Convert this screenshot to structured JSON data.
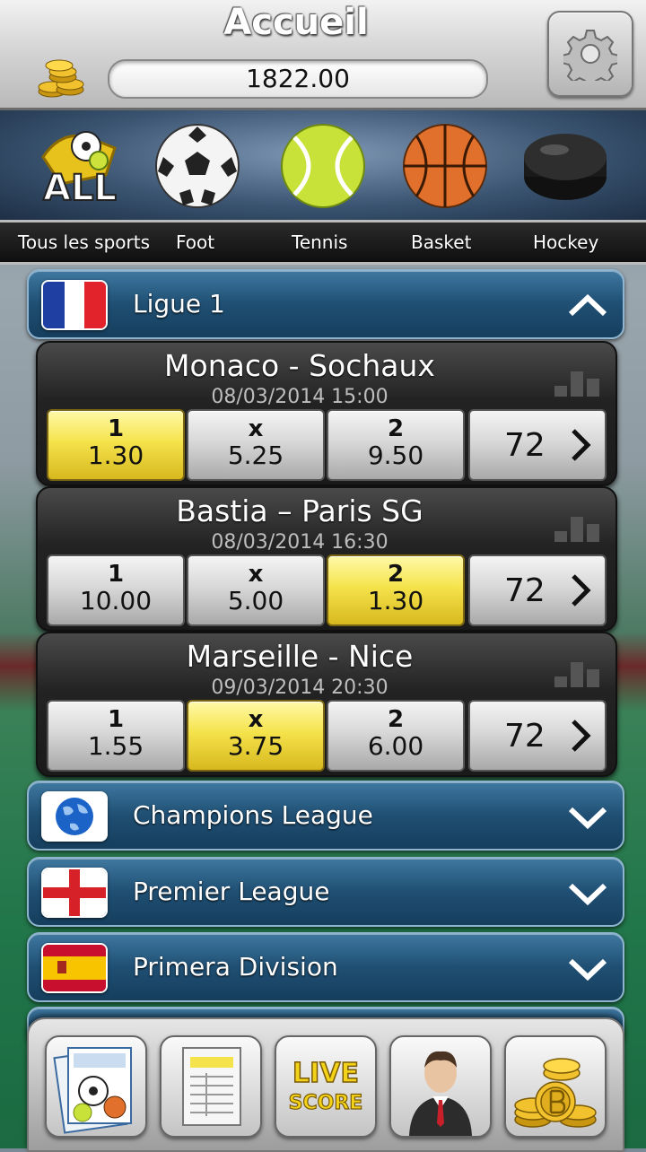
{
  "header": {
    "title": "Accueil",
    "balance": "1822.00",
    "settings_icon": "gear-icon"
  },
  "sports": [
    {
      "label": "Tous les sports",
      "icon": "all-sports-icon"
    },
    {
      "label": "Foot",
      "icon": "soccer-ball-icon"
    },
    {
      "label": "Tennis",
      "icon": "tennis-ball-icon"
    },
    {
      "label": "Basket",
      "icon": "basketball-icon"
    },
    {
      "label": "Hockey",
      "icon": "hockey-puck-icon"
    }
  ],
  "leagues": [
    {
      "name": "Ligue 1",
      "flag": "france-flag-icon",
      "expanded": true
    },
    {
      "name": "Champions League",
      "flag": "globe-icon",
      "expanded": false
    },
    {
      "name": "Premier League",
      "flag": "england-flag-icon",
      "expanded": false
    },
    {
      "name": "Primera Division",
      "flag": "spain-flag-icon",
      "expanded": false
    }
  ],
  "matches": [
    {
      "teams": "Monaco - Sochaux",
      "datetime": "08/03/2014 15:00",
      "odds": [
        {
          "label": "1",
          "value": "1.30"
        },
        {
          "label": "x",
          "value": "5.25"
        },
        {
          "label": "2",
          "value": "9.50"
        }
      ],
      "selected": "1",
      "more_count": "72"
    },
    {
      "teams": "Bastia – Paris SG",
      "datetime": "08/03/2014 16:30",
      "odds": [
        {
          "label": "1",
          "value": "10.00"
        },
        {
          "label": "x",
          "value": "5.00"
        },
        {
          "label": "2",
          "value": "1.30"
        }
      ],
      "selected": "2",
      "more_count": "72"
    },
    {
      "teams": "Marseille - Nice",
      "datetime": "09/03/2014 20:30",
      "odds": [
        {
          "label": "1",
          "value": "1.55"
        },
        {
          "label": "x",
          "value": "3.75"
        },
        {
          "label": "2",
          "value": "6.00"
        }
      ],
      "selected": "x",
      "more_count": "72"
    }
  ],
  "toolbar": {
    "buttons": [
      {
        "icon": "sports-newspaper-icon"
      },
      {
        "icon": "bet-slip-icon"
      },
      {
        "icon": "live-score-icon",
        "line1": "LIVE",
        "line2": "SCORE"
      },
      {
        "icon": "profile-businessman-icon"
      },
      {
        "icon": "gold-coins-icon"
      }
    ]
  },
  "colors": {
    "selected_odd": "#f5e34c",
    "league_bar": "#1f4f73",
    "match_bg": "#232323"
  }
}
